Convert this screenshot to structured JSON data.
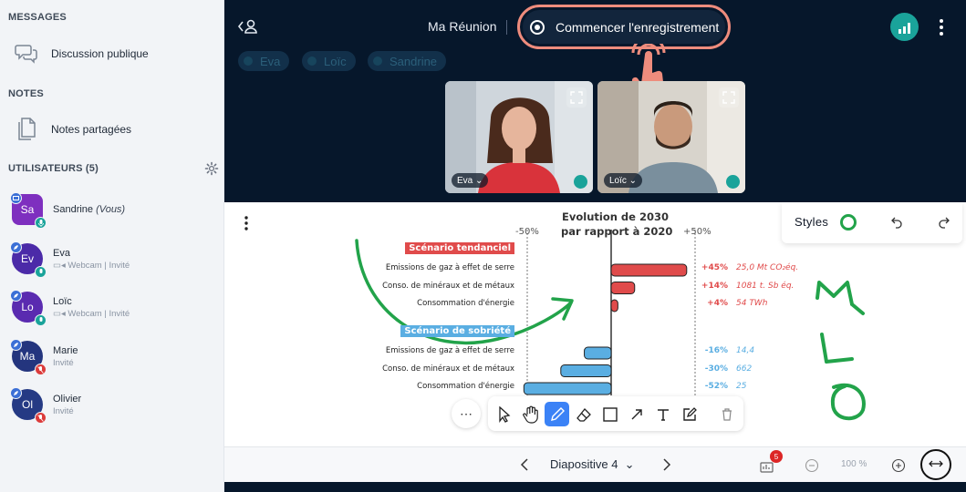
{
  "sidebar": {
    "messages_title": "MESSAGES",
    "public_chat": "Discussion publique",
    "notes_title": "NOTES",
    "shared_notes": "Notes partagées",
    "users_title": "UTILISATEURS (5)",
    "users": [
      {
        "initials": "Sa",
        "name": "Sandrine",
        "suffix": "(Vous)",
        "sub": "",
        "color": "#7e2fbf",
        "shape": "square"
      },
      {
        "initials": "Ev",
        "name": "Eva",
        "suffix": "",
        "sub": "Webcam | Invité",
        "color": "#4b2aa8",
        "shape": "round"
      },
      {
        "initials": "Lo",
        "name": "Loïc",
        "suffix": "",
        "sub": "Webcam | Invité",
        "color": "#5a2bb0",
        "shape": "round"
      },
      {
        "initials": "Ma",
        "name": "Marie",
        "suffix": "",
        "sub": "Invité",
        "color": "#24357e",
        "shape": "round"
      },
      {
        "initials": "Ol",
        "name": "Olivier",
        "suffix": "",
        "sub": "Invité",
        "color": "#253a84",
        "shape": "round"
      }
    ]
  },
  "topbar": {
    "meeting_title": "Ma Réunion",
    "record_label": "Commencer l'enregistrement"
  },
  "talkers": [
    "Eva",
    "Loïc",
    "Sandrine"
  ],
  "videos": [
    {
      "name": "Eva"
    },
    {
      "name": "Loïc"
    }
  ],
  "styles": {
    "label": "Styles"
  },
  "slide": {
    "label": "Diapositive 4",
    "notification_count": "5",
    "zoom": "100 %"
  },
  "chart_data": {
    "type": "bar",
    "title": "Evolution de 2030\npar rapport à 2020",
    "title_line1": "Evolution de 2030",
    "title_line2": "par rapport à 2020",
    "axis_left": "-50%",
    "axis_right": "+50%",
    "groups": [
      {
        "name": "Scénario tendanciel",
        "color": "#e04b4b",
        "rows": [
          {
            "category": "Emissions de gaz à effet de serre",
            "value": 45,
            "pct_label": "+45%",
            "detail": "25,0 Mt CO₂éq."
          },
          {
            "category": "Conso. de minéraux et de métaux",
            "value": 14,
            "pct_label": "+14%",
            "detail": "1081 t. Sb éq."
          },
          {
            "category": "Consommation d'énergie",
            "value": 4,
            "pct_label": "+4%",
            "detail": "54 TWh"
          }
        ]
      },
      {
        "name": "Scénario de sobriété",
        "color": "#5aaee2",
        "rows": [
          {
            "category": "Emissions de gaz à effet de serre",
            "value": -16,
            "pct_label": "-16%",
            "detail": "14,4"
          },
          {
            "category": "Conso. de minéraux et de métaux",
            "value": -30,
            "pct_label": "-30%",
            "detail": "662"
          },
          {
            "category": "Consommation d'énergie",
            "value": -52,
            "pct_label": "-52%",
            "detail": "25"
          }
        ]
      }
    ],
    "xlim": [
      -50,
      50
    ]
  },
  "colors": {
    "accent_teal": "#1aa39a",
    "record_outline": "#ee8c7d",
    "annotation_green": "#22a34a",
    "active_tool": "#3b82f6"
  }
}
